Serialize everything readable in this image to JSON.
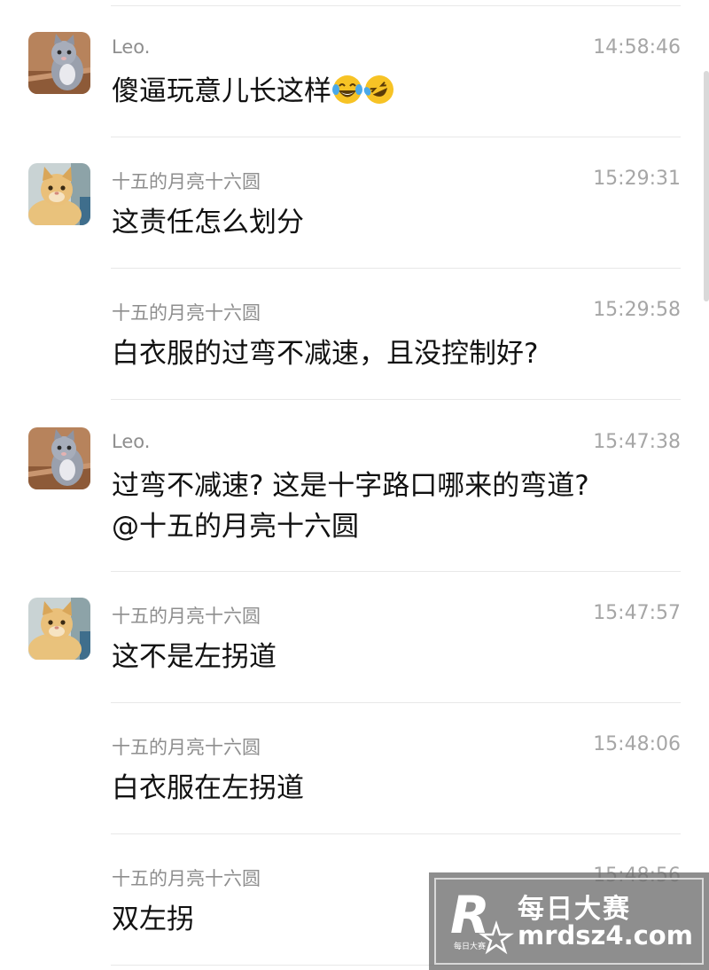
{
  "messages": [
    {
      "sender": "Leo.",
      "time": "14:58:46",
      "text": "傻逼玩意儿长这样",
      "emojis": [
        "laughing-tears-emoji",
        "rolling-laughing-emoji"
      ],
      "avatar": "gray-kitten-avatar"
    },
    {
      "sender": "十五的月亮十六圆",
      "time": "15:29:31",
      "text": "这责任怎么划分",
      "avatar": "orange-cat-avatar"
    },
    {
      "sender": "十五的月亮十六圆",
      "time": "15:29:58",
      "text": "白衣服的过弯不减速，且没控制好?"
    },
    {
      "sender": "Leo.",
      "time": "15:47:38",
      "text": "过弯不减速? 这是十字路口哪来的弯道?",
      "text2": "@十五的月亮十六圆",
      "avatar": "gray-kitten-avatar"
    },
    {
      "sender": "十五的月亮十六圆",
      "time": "15:47:57",
      "text": "这不是左拐道",
      "avatar": "orange-cat-avatar"
    },
    {
      "sender": "十五的月亮十六圆",
      "time": "15:48:06",
      "text": "白衣服在左拐道"
    },
    {
      "sender": "十五的月亮十六圆",
      "time": "15:48:56",
      "text": "双左拐"
    }
  ],
  "watermark": {
    "title": "每日大赛",
    "url": "mrdsz4.com",
    "logo_letter": "R",
    "logo_small": "每日大赛"
  },
  "colors": {
    "sender": "#8e8e8e",
    "time": "#a6a6a6",
    "text": "#111111",
    "divider": "#e8e8e8"
  }
}
